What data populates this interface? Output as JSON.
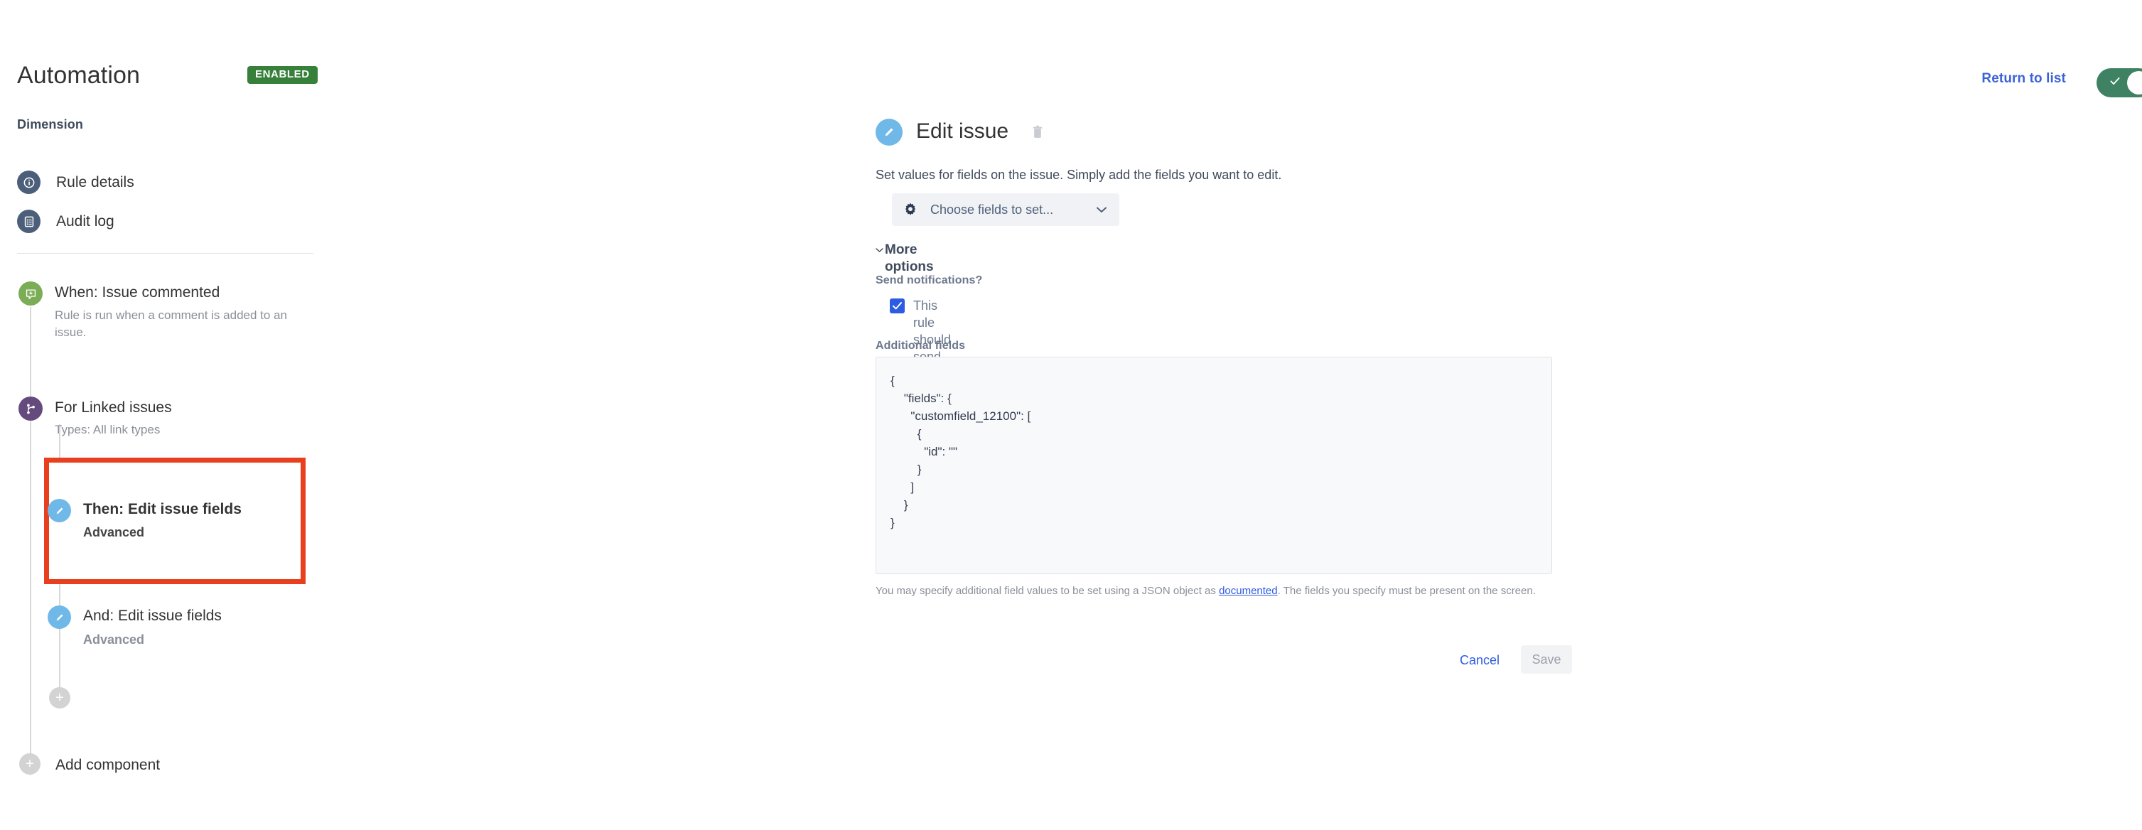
{
  "header": {
    "rule_title": "Automation",
    "status_badge": "ENABLED",
    "return_to_list": "Return to list",
    "toggle_state": "on",
    "toggle_color": "#3f8263",
    "badge_color": "#36803a"
  },
  "sidebar": {
    "section_label": "Dimension",
    "nav": [
      {
        "label": "Rule details",
        "icon": "info-circle-icon",
        "color": "#4c5f7a"
      },
      {
        "label": "Audit log",
        "icon": "list-document-icon",
        "color": "#4c5f7a"
      }
    ],
    "flow": [
      {
        "title": "When: Issue commented",
        "subtitle": "Rule is run when a comment is added to an issue.",
        "icon": "comment-trigger-icon",
        "color": "#7bad57"
      },
      {
        "title": "For Linked issues",
        "subtitle": "Types: All link types",
        "icon": "branch-icon",
        "color": "#654a7d"
      },
      {
        "title": "Then: Edit issue fields",
        "subtitle": "Advanced",
        "icon": "pencil-icon",
        "color": "#6fb8e8",
        "selected": true,
        "highlight_color": "#e8401f"
      },
      {
        "title": "And: Edit issue fields",
        "subtitle": "Advanced",
        "icon": "pencil-icon",
        "color": "#6fb8e8"
      }
    ],
    "add_component": "Add component",
    "add_child_icon": "plus-icon",
    "add_root_icon": "plus-icon"
  },
  "panel": {
    "icon": "pencil-icon",
    "title": "Edit issue",
    "delete_icon": "trash-icon",
    "description": "Set values for fields on the issue. Simply add the fields you want to edit.",
    "choose_fields": {
      "icon": "gear-icon",
      "label": "Choose fields to set...",
      "caret": "⌄"
    },
    "more_options": {
      "caret": "⌄",
      "label": "More options"
    },
    "send_notifications_label": "Send notifications?",
    "email_checkbox": {
      "label": "This rule should send emails",
      "checked": true,
      "color": "#2d5be3"
    },
    "additional_fields_label": "Additional fields",
    "code": "{\n    \"fields\": {\n      \"customfield_12100\": [\n        {\n          \"id\": \"\"\n        }\n      ]\n    }\n}",
    "helper_text_before": "You may specify additional field values to be set using a JSON object as ",
    "helper_link": "documented",
    "helper_text_after": ". The fields you specify must be present on the screen.",
    "cancel_label": "Cancel",
    "save_label": "Save"
  }
}
